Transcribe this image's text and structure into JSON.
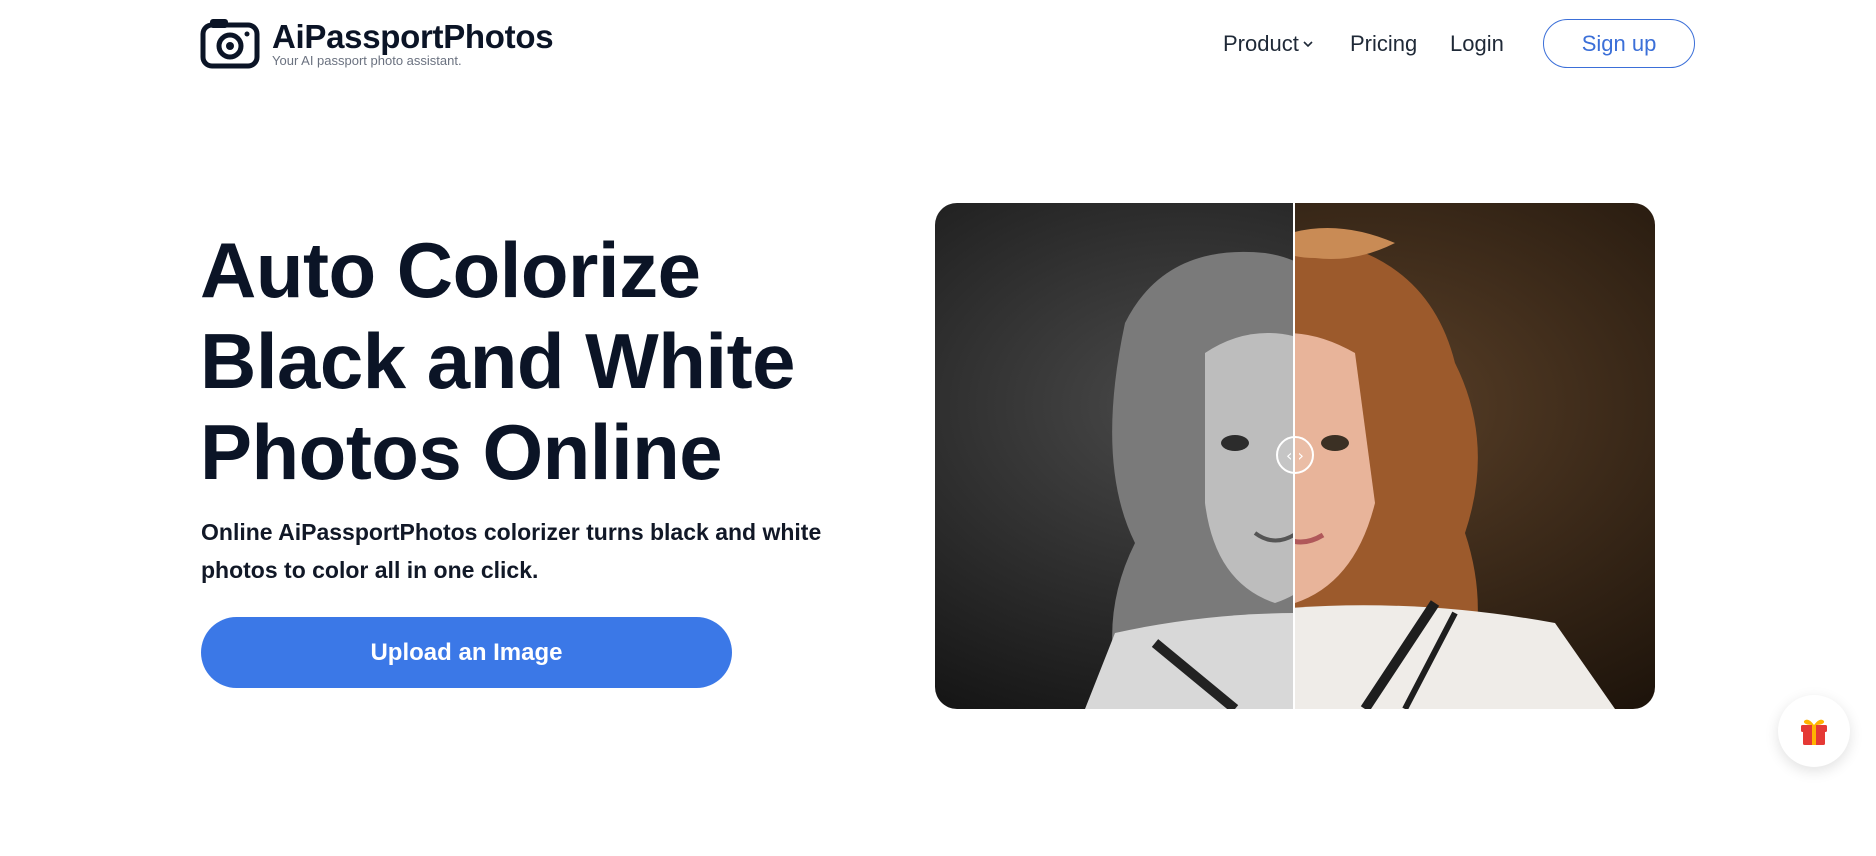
{
  "header": {
    "brand_name": "AiPassportPhotos",
    "brand_tagline": "Your AI passport photo assistant.",
    "nav": {
      "product_label": "Product",
      "pricing_label": "Pricing",
      "login_label": "Login"
    },
    "signup_label": "Sign up"
  },
  "hero": {
    "title": "Auto Colorize Black and White Photos Online",
    "subtitle": "Online AiPassportPhotos colorizer turns black and white photos to color all in one click.",
    "upload_label": "Upload an Image"
  },
  "comparison": {
    "handle_glyph": "‹ ›"
  },
  "icons": {
    "logo": "camera-logo-icon",
    "product_dropdown": "chevron-down-icon",
    "gift": "gift-icon"
  },
  "colors": {
    "primary": "#3b78e7",
    "signup_border": "#3b6fd8",
    "text_dark": "#0b1426",
    "gift_red": "#e53935"
  }
}
